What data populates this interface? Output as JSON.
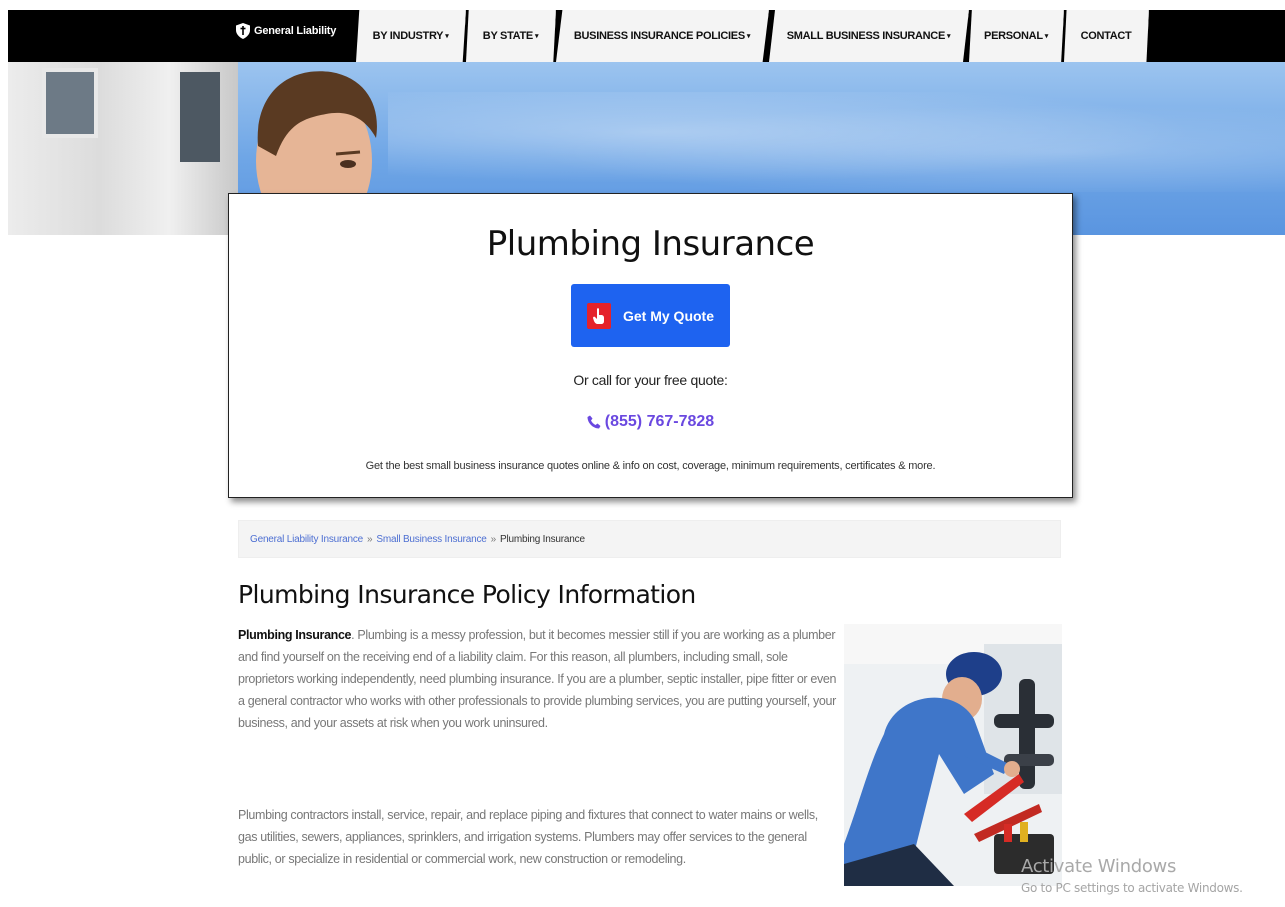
{
  "nav": {
    "logo_text": "General Liability",
    "items": [
      {
        "label": "BY INDUSTRY",
        "dropdown": true
      },
      {
        "label": "BY STATE",
        "dropdown": true
      },
      {
        "label": "BUSINESS INSURANCE POLICIES",
        "dropdown": true
      },
      {
        "label": "SMALL BUSINESS INSURANCE",
        "dropdown": true
      },
      {
        "label": "PERSONAL",
        "dropdown": true
      },
      {
        "label": "CONTACT",
        "dropdown": false
      }
    ],
    "caret": "▾"
  },
  "card": {
    "title": "Plumbing Insurance",
    "cta_label": "Get My Quote",
    "call_text": "Or call for your free quote:",
    "phone": "(855) 767-7828",
    "tagline": "Get the best small business insurance quotes online & info on cost, coverage, minimum requirements, certificates & more."
  },
  "breadcrumb": {
    "items": [
      "General Liability Insurance",
      "Small Business Insurance"
    ],
    "separator": "»",
    "current": "Plumbing Insurance"
  },
  "article": {
    "heading": "Plumbing Insurance Policy Information",
    "p1_bold": "Plumbing Insurance",
    "p1_rest": ". Plumbing is a messy profession, but it becomes messier still if you are working as a plumber and find yourself on the receiving end of a liability claim. For this reason, all plumbers, including small, sole proprietors working independently, need plumbing insurance. If you are a plumber, septic installer, pipe fitter or even a general contractor who works with other professionals to provide plumbing services, you are putting yourself, your business, and your assets at risk when you work uninsured.",
    "p2": "Plumbing contractors install, service, repair, and replace piping and fixtures that connect to water mains or wells, gas utilities, sewers, appliances, sprinklers, and irrigation systems. Plumbers may offer services to the general public, or specialize in residential or commercial work, new construction or remodeling."
  },
  "watermark": {
    "title": "Activate Windows",
    "subtitle": "Go to PC settings to activate Windows."
  },
  "icons": {
    "logo": "shield-icon",
    "cta": "hand-pointer-icon",
    "phone": "phone-icon"
  },
  "colors": {
    "nav_bg": "#000000",
    "cta_bg": "#1e63f0",
    "cta_icon_bg": "#e5222a",
    "phone": "#6a48e0",
    "link": "#4d6fd2"
  }
}
